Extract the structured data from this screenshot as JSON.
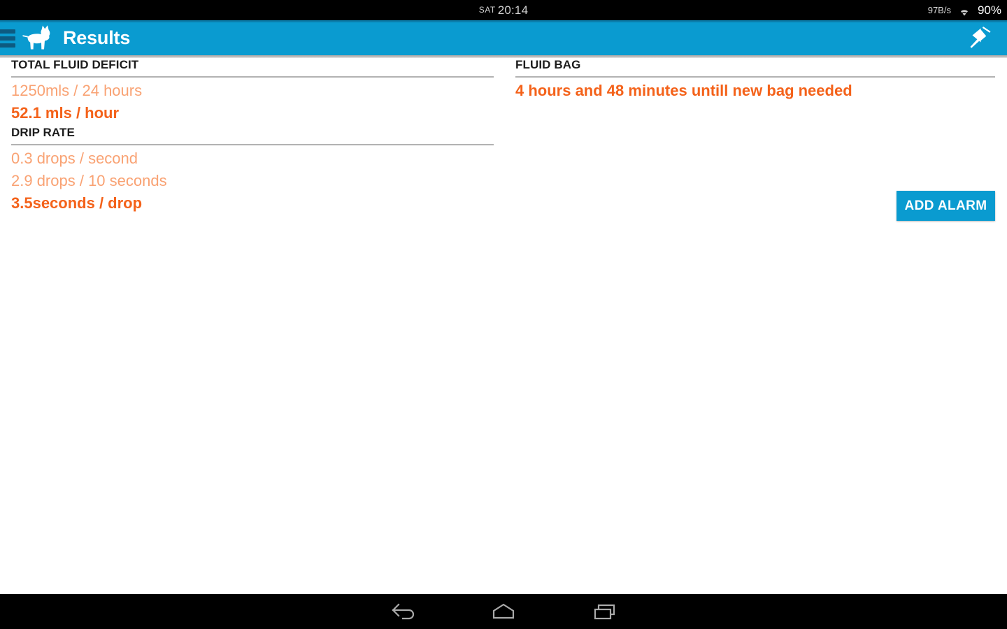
{
  "status_bar": {
    "day_of_week": "SAT",
    "time": "20:14",
    "network_speed": "97B/s",
    "wifi_icon": "wifi-icon",
    "battery": "90%"
  },
  "app_bar": {
    "menu_icon": "hamburger-menu-icon",
    "logo_icon": "dog-logo-icon",
    "title": "Results",
    "pin_icon": "pushpin-icon",
    "background_color": "#0a9bd0"
  },
  "content": {
    "left_column": {
      "sections": [
        {
          "header": "TOTAL FLUID DEFICIT",
          "lines": [
            {
              "text": "1250mls / 24 hours",
              "emphasis": "muted"
            },
            {
              "text": "52.1 mls / hour",
              "emphasis": "strong"
            }
          ]
        },
        {
          "header": "DRIP RATE",
          "lines": [
            {
              "text": "0.3 drops / second",
              "emphasis": "muted"
            },
            {
              "text": "2.9 drops / 10 seconds",
              "emphasis": "muted"
            },
            {
              "text": "3.5seconds / drop",
              "emphasis": "strong"
            }
          ]
        }
      ]
    },
    "right_column": {
      "sections": [
        {
          "header": "FLUID BAG",
          "lines": [
            {
              "text": "4 hours and 48 minutes untill new bag needed",
              "emphasis": "strong"
            }
          ]
        }
      ],
      "add_alarm_label": "ADD ALARM"
    }
  },
  "nav_bar": {
    "back_icon": "back-arrow-icon",
    "home_icon": "home-icon",
    "recents_icon": "recent-apps-icon"
  },
  "colors": {
    "accent_blue": "#0a9bd0",
    "orange_strong": "#f4621a",
    "orange_muted": "#f9a273",
    "divider_gray": "#b2b2b2"
  }
}
